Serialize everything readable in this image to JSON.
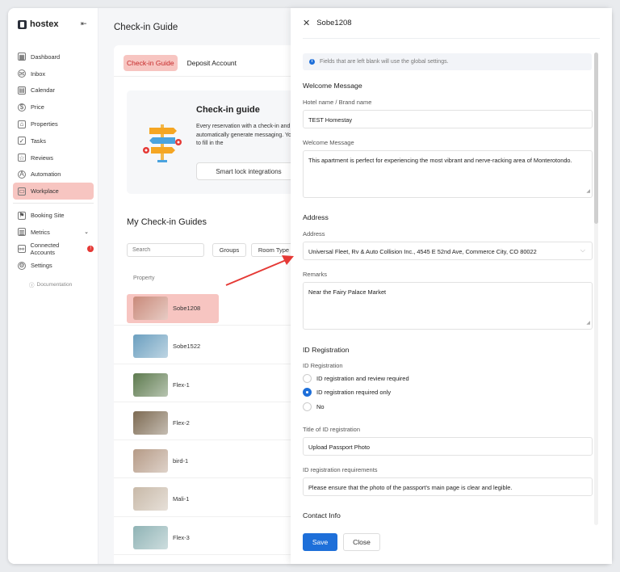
{
  "app": {
    "brand": "hostex"
  },
  "sidebar": {
    "items": [
      {
        "label": "Dashboard",
        "icon": "dashboard-icon",
        "glyph": "▦"
      },
      {
        "label": "Inbox",
        "icon": "inbox-icon",
        "glyph": "✉"
      },
      {
        "label": "Calendar",
        "icon": "calendar-icon",
        "glyph": "▤"
      },
      {
        "label": "Price",
        "icon": "price-icon",
        "glyph": "$"
      },
      {
        "label": "Properties",
        "icon": "home-icon",
        "glyph": "⌂"
      },
      {
        "label": "Tasks",
        "icon": "tasks-icon",
        "glyph": "✓"
      },
      {
        "label": "Reviews",
        "icon": "star-icon",
        "glyph": "☆"
      },
      {
        "label": "Automation",
        "icon": "automation-icon",
        "glyph": "A"
      },
      {
        "label": "Workplace",
        "icon": "workplace-icon",
        "glyph": "▭"
      }
    ],
    "items2": [
      {
        "label": "Booking Site",
        "icon": "booking-site-icon",
        "glyph": "⚑"
      },
      {
        "label": "Metrics",
        "icon": "metrics-icon",
        "glyph": "▥"
      },
      {
        "label": "Connected Accounts",
        "icon": "connected-accounts-icon",
        "glyph": "⚯",
        "badge": "!"
      },
      {
        "label": "Settings",
        "icon": "settings-icon",
        "glyph": "⚙"
      }
    ],
    "documentation": "Documentation"
  },
  "main": {
    "title": "Check-in Guide",
    "tabs": [
      "Check-in Guide",
      "Deposit Account"
    ],
    "guide_title": "Check-in guide",
    "guide_desc": "Every reservation with a check-in and even automatically generate messaging. You need to fill in the",
    "smart_lock_button": "Smart lock integrations",
    "my_title": "My Check-in Guides",
    "search_placeholder": "Search",
    "filters": [
      "Groups",
      "Room Type"
    ],
    "col_property": "Property",
    "properties": [
      {
        "name": "Sobe1208",
        "thumb": "#c98a7a"
      },
      {
        "name": "Sobe1522",
        "thumb": "#6b9fbf"
      },
      {
        "name": "Flex-1",
        "thumb": "#5d7a4e"
      },
      {
        "name": "Flex-2",
        "thumb": "#7d6a52"
      },
      {
        "name": "bird-1",
        "thumb": "#b59a86"
      },
      {
        "name": "Mali-1",
        "thumb": "#c8b9a8"
      },
      {
        "name": "Flex-3",
        "thumb": "#8fb3b5"
      }
    ]
  },
  "drawer": {
    "title": "Sobe1208",
    "info": "Fields that are left blank will use the global settings.",
    "welcome_section": "Welcome Message",
    "hotel_label": "Hotel name / Brand name",
    "hotel_value": "TEST Homestay",
    "welcome_label": "Welcome Message",
    "welcome_value": "This apartment is perfect for experiencing the most vibrant and nerve-racking area of Monterotondo.",
    "address_section": "Address",
    "address_label": "Address",
    "address_value": "Universal Fleet, Rv & Auto Collision Inc., 4545 E 52nd Ave, Commerce City, CO 80022",
    "remarks_label": "Remarks",
    "remarks_value": "Near the Fairy Palace Market",
    "id_section": "ID Registration",
    "id_label": "ID Registration",
    "id_options": [
      "ID registration and review required",
      "ID registration required only",
      "No"
    ],
    "id_selected_index": 1,
    "id_title_label": "Title of ID registration",
    "id_title_value": "Upload Passport Photo",
    "id_req_label": "ID registration requirements",
    "id_req_value": "Please ensure that the photo of the passport's main page is clear and legible.",
    "contact_section": "Contact Info",
    "save": "Save",
    "close": "Close"
  },
  "colors": {
    "accent": "#1e6fd9",
    "highlight": "#f7c5c1",
    "arrow": "#e53935"
  }
}
